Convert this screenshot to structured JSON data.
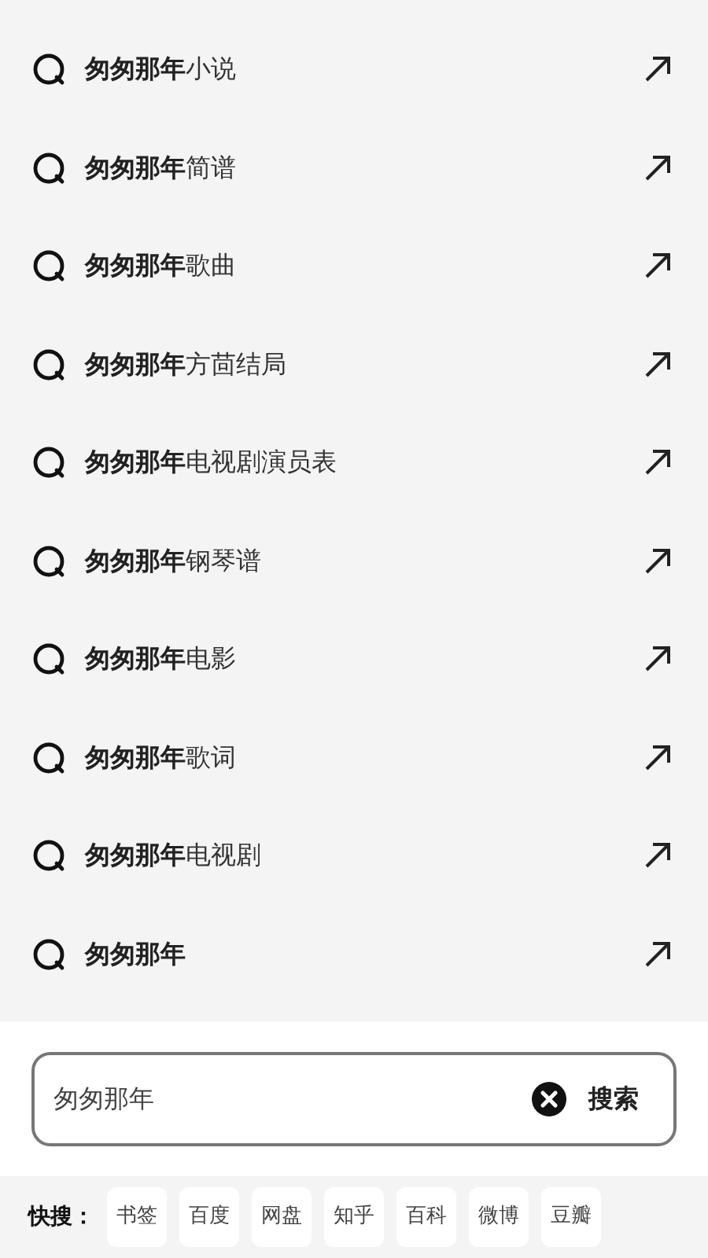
{
  "suggestions": [
    {
      "match": "匆匆那年",
      "rest": "小说"
    },
    {
      "match": "匆匆那年",
      "rest": "简谱"
    },
    {
      "match": "匆匆那年",
      "rest": "歌曲"
    },
    {
      "match": "匆匆那年",
      "rest": "方茴结局"
    },
    {
      "match": "匆匆那年",
      "rest": "电视剧演员表"
    },
    {
      "match": "匆匆那年",
      "rest": "钢琴谱"
    },
    {
      "match": "匆匆那年",
      "rest": "电影"
    },
    {
      "match": "匆匆那年",
      "rest": "歌词"
    },
    {
      "match": "匆匆那年",
      "rest": "电视剧"
    },
    {
      "match": "匆匆那年"
    }
  ],
  "search": {
    "value": "匆匆那年",
    "button": "搜索"
  },
  "quick_search": {
    "label": "快搜：",
    "items": [
      "书签",
      "百度",
      "网盘",
      "知乎",
      "百科",
      "微博",
      "豆瓣"
    ]
  }
}
